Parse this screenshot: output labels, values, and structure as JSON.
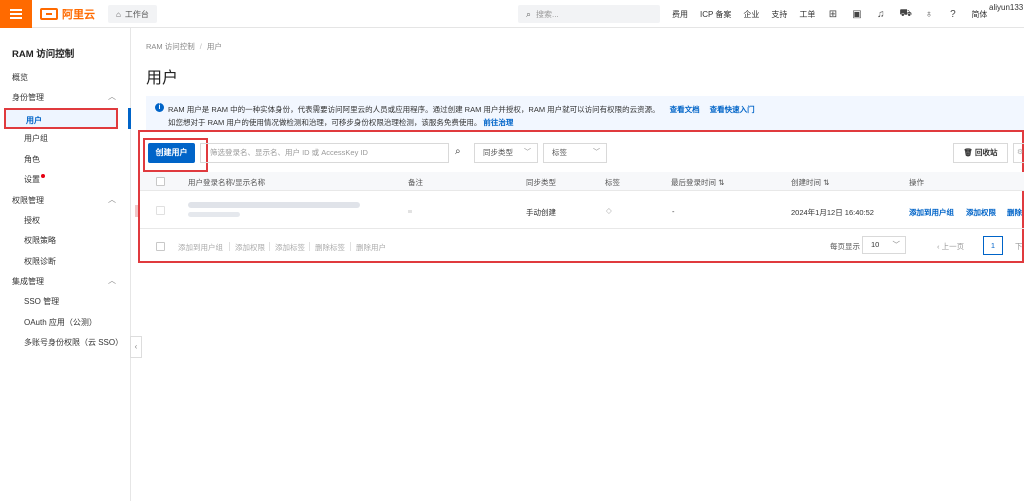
{
  "topbar": {
    "logo_text": "阿里云",
    "workbench": "工作台",
    "search_placeholder": "搜索...",
    "nav": [
      "费用",
      "ICP 备案",
      "企业",
      "支持",
      "工单"
    ],
    "lang": "简体",
    "user": "aliyun133"
  },
  "sidebar": {
    "title": "RAM 访问控制",
    "overview": "概览",
    "groups": [
      {
        "label": "身份管理",
        "items": [
          "用户",
          "用户组",
          "角色",
          "设置"
        ]
      },
      {
        "label": "权限管理",
        "items": [
          "授权",
          "权限策略",
          "权限诊断"
        ]
      },
      {
        "label": "集成管理",
        "items": [
          "SSO 管理",
          "OAuth 应用（公测）",
          "多账号身份权限（云 SSO）"
        ]
      }
    ]
  },
  "breadcrumb": [
    "RAM 访问控制",
    "用户"
  ],
  "page_title": "用户",
  "notice": {
    "line1": "RAM 用户是 RAM 中的一种实体身份，代表需要访问阿里云的人员或应用程序。通过创建 RAM 用户并授权，RAM 用户就可以访问有权限的云资源。",
    "link1": "查看文档",
    "link2": "查看快速入门",
    "line2": "如您想对于 RAM 用户的使用情况做检测和治理，可移步身份权限治理检测，该服务免费使用。",
    "link3": "前往治理"
  },
  "toolbar": {
    "create_button": "创建用户",
    "filter_placeholder": "筛选登录名、显示名、用户 ID 或 AccessKey ID",
    "sync_type": "同步类型",
    "tag": "标签",
    "recycle": "回收站"
  },
  "table": {
    "headers": [
      "用户登录名称/显示名称",
      "备注",
      "同步类型",
      "标签",
      "最后登录时间",
      "创建时间",
      "操作"
    ],
    "rows": [
      {
        "sync_type": "手动创建",
        "last_login": "-",
        "created": "2024年1月12日 16:40:52",
        "actions": [
          "添加到用户组",
          "添加权限",
          "删除"
        ]
      }
    ]
  },
  "bulk_actions": [
    "添加到用户组",
    "添加权限",
    "添加标签",
    "删除标签",
    "删除用户"
  ],
  "pagination": {
    "per_page_label": "每页显示",
    "per_page": "10",
    "prev": "上一页",
    "current": "1",
    "next": "下"
  },
  "colors": {
    "brand": "#ff6a00",
    "primary": "#0064c8",
    "highlight": "#e03a3e"
  }
}
